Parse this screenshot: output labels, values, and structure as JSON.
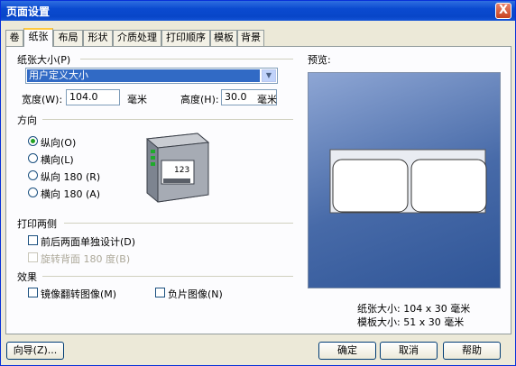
{
  "window": {
    "title": "页面设置",
    "close": "X"
  },
  "tabs": [
    "卷",
    "纸张",
    "布局",
    "形状",
    "介质处理",
    "打印顺序",
    "模板",
    "背景"
  ],
  "paper_size": {
    "group": "纸张大小(P)",
    "selected": "用户定义大小",
    "width_label": "宽度(W):",
    "width_value": "104.0",
    "width_unit": "毫米",
    "height_label": "高度(H):",
    "height_value": "30.0",
    "height_unit": "毫米"
  },
  "orientation": {
    "group": "方向",
    "options": [
      "纵向(O)",
      "横向(L)",
      "纵向 180 (R)",
      "横向 180 (A)"
    ],
    "selected": 0,
    "printer_text": "123"
  },
  "duplex": {
    "group": "打印两侧",
    "opt1": "前后两面单独设计(D)",
    "opt2": "旋转背面 180 度(B)"
  },
  "effects": {
    "group": "效果",
    "mirror": "镜像翻转图像(M)",
    "negative": "负片图像(N)"
  },
  "preview": {
    "label": "预览:",
    "paper_size": "纸张大小: 104 x 30 毫米",
    "template_size": "模板大小: 51 x 30 毫米"
  },
  "buttons": {
    "wizard": "向导(Z)...",
    "ok": "确定",
    "cancel": "取消",
    "help": "帮助"
  }
}
